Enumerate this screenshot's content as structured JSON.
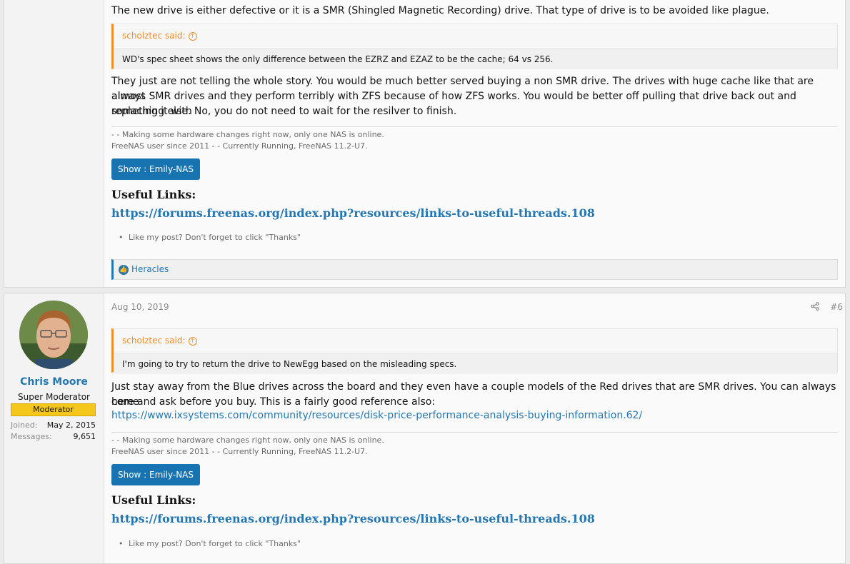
{
  "post1": {
    "intro_text": "The new drive is either defective or it is a SMR (Shingled Magnetic Recording) drive. That type of drive is to be avoided like plague.",
    "quote_author": "scholztec said:",
    "quote_text": "WD's spec sheet shows the only difference between the EZRZ and EZAZ to be the cache; 64 vs 256.",
    "body_lines": [
      "They just are not telling the whole story. You would be much better served buying a non SMR drive. The drives with huge cache like that are almost",
      "always SMR drives and they perform terribly with ZFS because of how ZFS works. You would be better off pulling that drive back out and replacing it with",
      "something else. No, you do not need to wait for the resilver to finish."
    ],
    "signature_lines": [
      "- - Making some hardware changes right now, only one NAS is online.",
      "FreeNAS user since 2011 - - Currently Running, FreeNAS 11.2-U7."
    ],
    "show_button": "Show : Emily-NAS",
    "useful_links_title": "Useful Links:",
    "useful_links_url": "https://forums.freenas.org/index.php?resources/links-to-useful-threads.108",
    "bullet": "Like my post? Don't forget to click \"Thanks\"",
    "reaction_user": "Heracles"
  },
  "post2": {
    "user": {
      "name": "Chris Moore",
      "title": "Super Moderator",
      "badge": "Moderator",
      "joined_label": "Joined:",
      "joined_value": "May 2, 2015",
      "messages_label": "Messages:",
      "messages_value": "9,651"
    },
    "date": "Aug 10, 2019",
    "post_number": "#6",
    "quote_author": "scholztec said:",
    "quote_text": "I'm going to try to return the drive to NewEgg based on the misleading specs.",
    "body_lines": [
      "Just stay away from the Blue drives across the board and they even have a couple models of the Red drives that are SMR drives. You can always come",
      "here and ask before you buy. This is a fairly good reference also:"
    ],
    "body_link": "https://www.ixsystems.com/community/resources/disk-price-performance-analysis-buying-information.62/",
    "signature_lines": [
      "- - Making some hardware changes right now, only one NAS is online.",
      "FreeNAS user since 2011 - - Currently Running, FreeNAS 11.2-U7."
    ],
    "show_button": "Show : Emily-NAS",
    "useful_links_title": "Useful Links:",
    "useful_links_url": "https://forums.freenas.org/index.php?resources/links-to-useful-threads.108",
    "bullet": "Like my post? Don't forget to click \"Thanks\""
  },
  "icons": {
    "quote_arrow": "arrow-up-circle-icon",
    "reaction": "thumbs-up-icon",
    "share": "share-icon"
  },
  "colors": {
    "accent": "#2577b1",
    "quote_accent": "#f28c28",
    "button": "#1774b0",
    "badge": "#f5c61b"
  }
}
